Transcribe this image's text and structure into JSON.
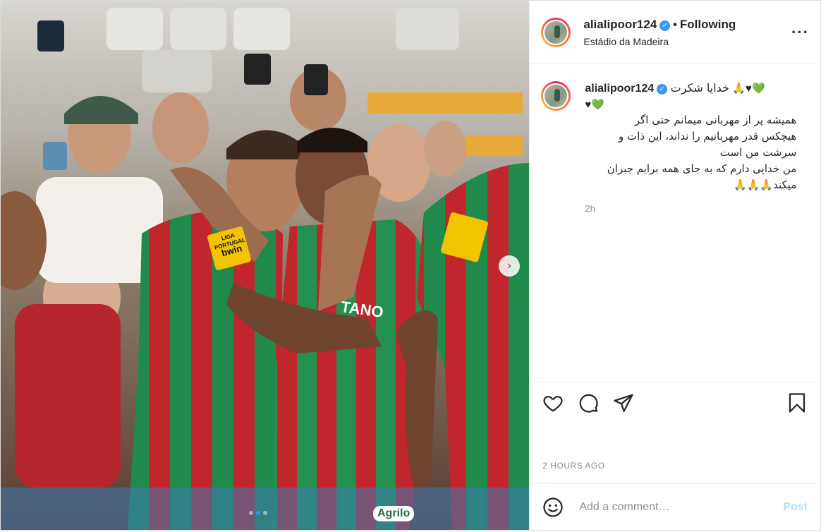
{
  "post": {
    "username": "alialipoor124",
    "verified_badge": "✓",
    "follow_status": "Following",
    "location": "Estádio da Madeira",
    "more_icon": "more-options-icon",
    "caption": {
      "username": "alialipoor124",
      "line1_text": "خدایا شکرت",
      "line1_emoji": "🙏♥💚",
      "line2_emoji": "♥💚",
      "body_lines": [
        "همیشه پر از مهربانی میمانم حتی اگر",
        "هیچکس قدر مهربانیم را نداند، این ذات و",
        "سرشت من است",
        "من خدایی دارم که به جای همه برایم جبران",
        "میکند🙏🙏🙏"
      ],
      "time_short": "2h"
    },
    "actions": {
      "like_icon": "heart-icon",
      "comment_icon": "comment-icon",
      "share_icon": "share-icon",
      "save_icon": "bookmark-icon"
    },
    "timestamp": "2 HOURS AGO",
    "comment": {
      "emoji_icon": "emoji-icon",
      "placeholder": "Add a comment…",
      "post_label": "Post"
    },
    "carousel": {
      "next_icon": "chevron-right-icon",
      "next_glyph": "›",
      "active_index": 1,
      "count": 3
    }
  },
  "photo_text": {
    "sponsor_badge_top": "LIGA PORTUGAL",
    "sponsor_badge_bottom": "bwin",
    "jersey_text": "TANO",
    "shorts_text": "Agrilo"
  },
  "colors": {
    "link_blue": "#3897f0",
    "post_disabled": "#b2dffc",
    "jersey_green": "#1f8a4c",
    "jersey_red": "#c0262b"
  }
}
